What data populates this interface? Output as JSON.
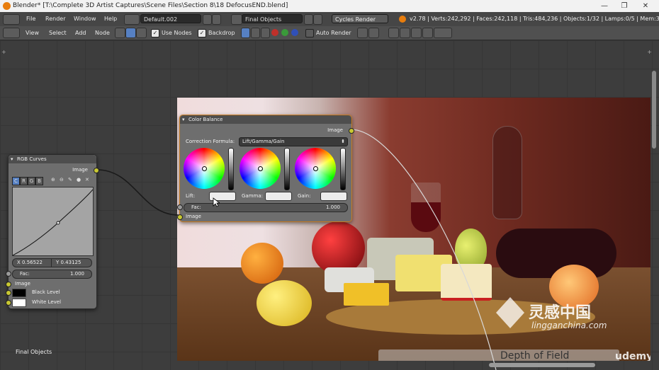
{
  "window": {
    "title": "Blender* [T:\\Complete 3D Artist Captures\\Scene Files\\Section 8\\18 DefocusEND.blend]",
    "minimize": "—",
    "restore": "❐",
    "close": "✕"
  },
  "menubar": {
    "items": [
      "File",
      "Render",
      "Window",
      "Help"
    ],
    "screen_layout": "Default.002",
    "scene": "Final Objects",
    "render_engine": "Cycles Render",
    "stats": "v2.78 | Verts:242,292 | Faces:242,118 | Tris:484,236 | Objects:1/32 | Lamps:0/5 | Mem:3112"
  },
  "node_header": {
    "items": [
      "View",
      "Select",
      "Add",
      "Node"
    ],
    "use_nodes": "Use Nodes",
    "backdrop": "Backdrop",
    "auto_render": "Auto Render"
  },
  "rgb_curves": {
    "title": "RGB Curves",
    "output": "Image",
    "channels": [
      "C",
      "R",
      "G",
      "B"
    ],
    "x_value": "X 0.56522",
    "y_value": "Y 0.43125",
    "fac_label": "Fac:",
    "fac_value": "1.000",
    "input_image": "Image",
    "black_level": "Black Level",
    "white_level": "White Level"
  },
  "color_balance": {
    "title": "Color Balance",
    "output": "Image",
    "formula_label": "Correction Formula:",
    "formula_value": "Lift/Gamma/Gain",
    "lift": "Lift:",
    "gamma": "Gamma:",
    "gain": "Gain:",
    "fac_label": "Fac:",
    "fac_value": "1.000",
    "input_image": "Image"
  },
  "footer": {
    "scene_label": "Final Objects",
    "overlay_text": "Depth of Field"
  },
  "watermark": {
    "brand": "灵感中国",
    "url": "lingganchina.com",
    "udemy": "udemy"
  }
}
